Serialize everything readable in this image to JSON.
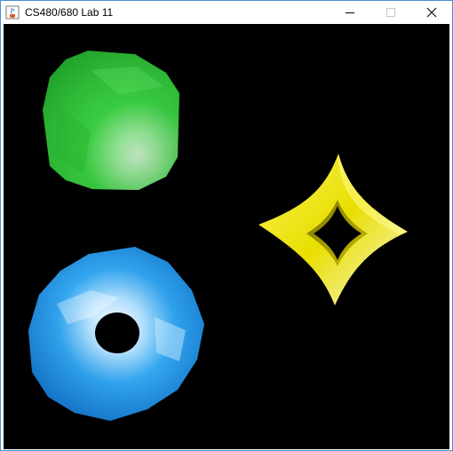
{
  "window": {
    "title": "CS480/680 Lab 11",
    "app_icon": "java-cup-icon",
    "buttons": {
      "minimize_icon": "minimize-icon",
      "maximize_icon": "maximize-icon",
      "close_icon": "close-icon"
    }
  },
  "scene": {
    "background": "#000000",
    "objects": [
      {
        "name": "green-rounded-cube",
        "color": "#2fc43a"
      },
      {
        "name": "yellow-star-ring",
        "color": "#e6e000"
      },
      {
        "name": "blue-torus",
        "color": "#1e8fe0"
      }
    ]
  }
}
